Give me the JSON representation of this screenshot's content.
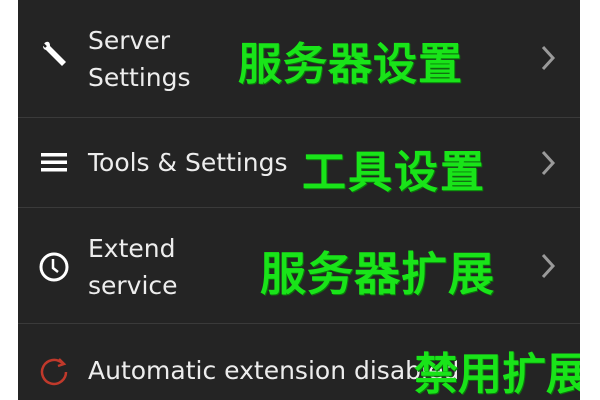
{
  "menu": {
    "items": [
      {
        "label": "Server Settings",
        "annotation": "服务器设置",
        "icon": "wrench-icon",
        "has_chevron": true
      },
      {
        "label": "Tools & Settings",
        "annotation": "工具设置",
        "icon": "hamburger-menu-icon",
        "has_chevron": true
      },
      {
        "label": "Extend service",
        "annotation": "服务器扩展",
        "icon": "clock-icon",
        "has_chevron": true
      },
      {
        "label": "Automatic extension disabled",
        "annotation": "禁用扩展",
        "icon": "refresh-icon",
        "has_chevron": false
      }
    ]
  },
  "colors": {
    "background": "#242424",
    "text": "#ededed",
    "annotation": "#19e419",
    "disabled_icon": "#c0392b",
    "chevron": "#9a9a9a"
  }
}
